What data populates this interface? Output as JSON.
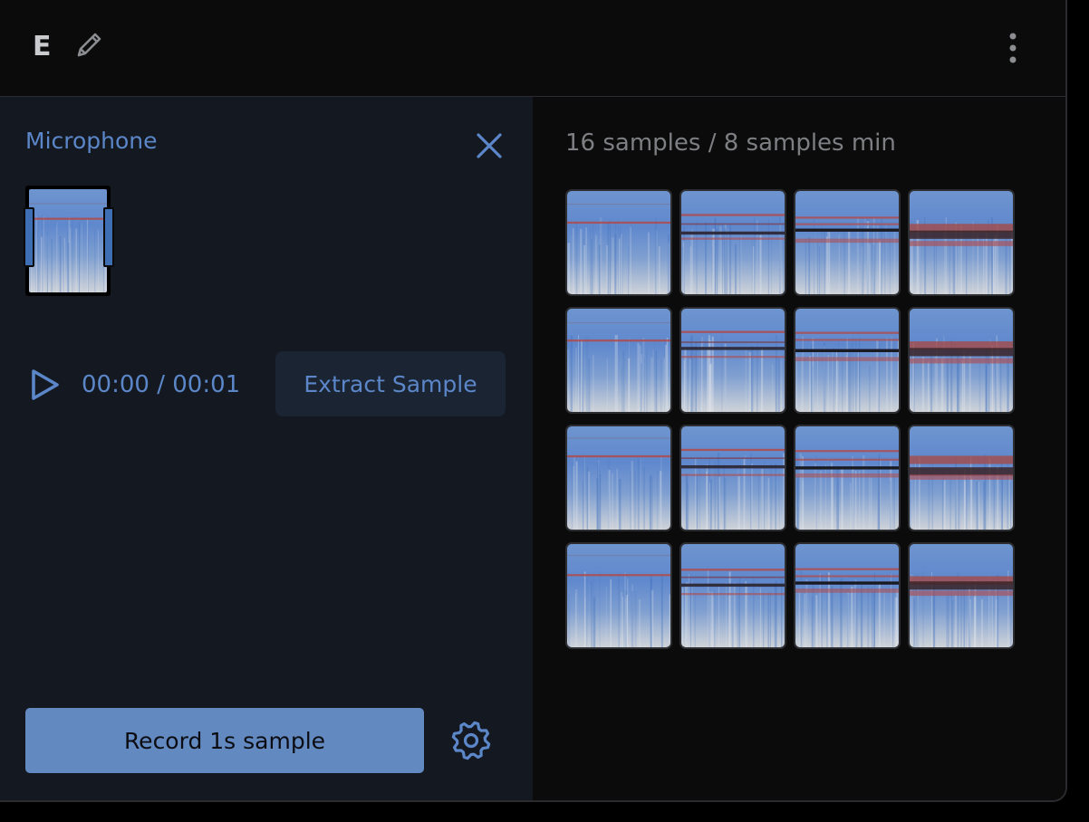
{
  "header": {
    "class_name": "E",
    "edit_icon": "pencil-icon",
    "menu_icon": "more-vertical-icon"
  },
  "recorder": {
    "source_label": "Microphone",
    "close_icon": "close-icon",
    "play_icon": "play-icon",
    "current_time": "00:00",
    "time_separator": "/",
    "duration": "00:01",
    "extract_label": "Extract Sample",
    "record_label": "Record 1s sample",
    "settings_icon": "gear-icon"
  },
  "samples": {
    "summary": "16 samples / 8 samples min",
    "count": 16,
    "columns": 4
  },
  "colors": {
    "accent": "#5b86c8",
    "record_button": "#6389c1",
    "left_panel": "#141821",
    "background": "#0b0b0c",
    "spectrogram_high": "#b04a4a",
    "spectrogram_low": "#4f7fc8"
  }
}
